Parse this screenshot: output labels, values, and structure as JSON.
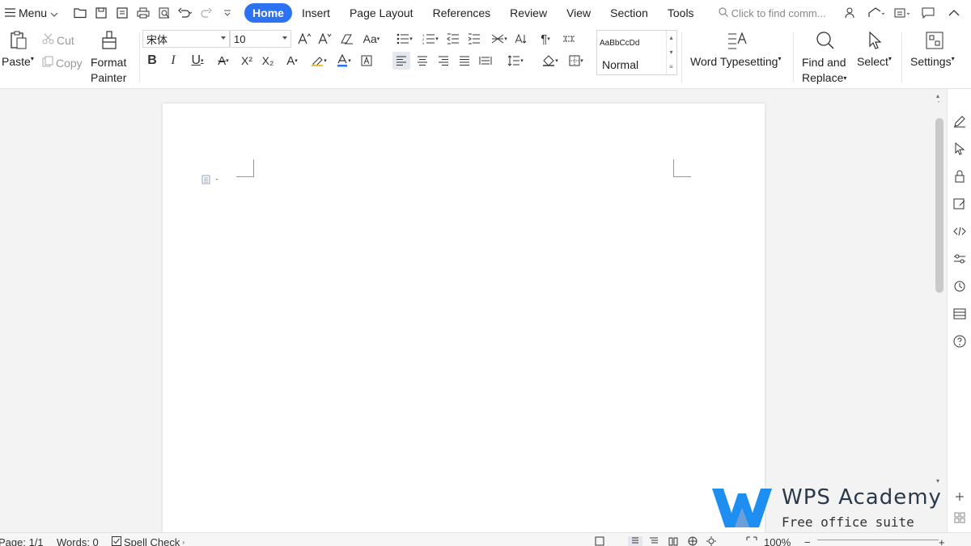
{
  "menubar": {
    "menu_label": "Menu",
    "tabs": [
      {
        "label": "Home"
      },
      {
        "label": "Insert"
      },
      {
        "label": "Page Layout"
      },
      {
        "label": "References"
      },
      {
        "label": "Review"
      },
      {
        "label": "View"
      },
      {
        "label": "Section"
      },
      {
        "label": "Tools"
      }
    ],
    "search_placeholder": "Click to find comm..."
  },
  "ribbon": {
    "paste": "Paste",
    "cut": "Cut",
    "copy": "Copy",
    "format_painter_1": "Format",
    "format_painter_2": "Painter",
    "font_name": "宋体",
    "font_size": "10",
    "style_sample": "AaBbCcDd",
    "style_name": "Normal",
    "word_typesetting": "Word Typesetting",
    "find_replace_1": "Find and",
    "find_replace_2": "Replace",
    "select": "Select",
    "settings": "Settings"
  },
  "statusbar": {
    "page": "Page: 1/1",
    "words": "Words: 0",
    "spell_check": "Spell Check",
    "zoom": "100%"
  },
  "watermark": {
    "title": "WPS Academy",
    "subtitle": "Free office suite tutorials"
  },
  "colors": {
    "accent": "#2b73f0",
    "logo_blue": "#1e8ff0"
  }
}
